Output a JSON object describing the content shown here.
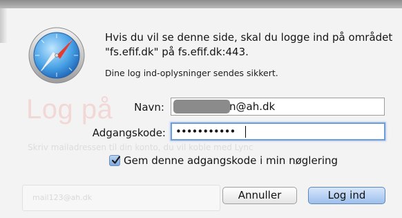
{
  "background_page": {
    "title": "Log på",
    "description": "Skriv mailadressen til din konto, du vil koble med Lync",
    "field_value": "mail123@ah.dk"
  },
  "dialog": {
    "message": "Hvis du vil se denne side, skal du logge ind på området \"fs.efif.dk\" på fs.efif.dk:443.",
    "secure_note": "Dine log ind-oplysninger sendes sikkert.",
    "username_label": "Navn:",
    "username_value_visible": "n@ah.dk",
    "password_label": "Adgangskode:",
    "password_mask": "•••••••••••",
    "remember_label": "Gem denne adgangskode i min nøglering",
    "remember_checked": true,
    "cancel_label": "Annuller",
    "login_label": "Log ind",
    "icon": "safari-compass-icon"
  },
  "colors": {
    "accent_blue": "#6e9ed9",
    "default_button": "#9dc0ec"
  }
}
